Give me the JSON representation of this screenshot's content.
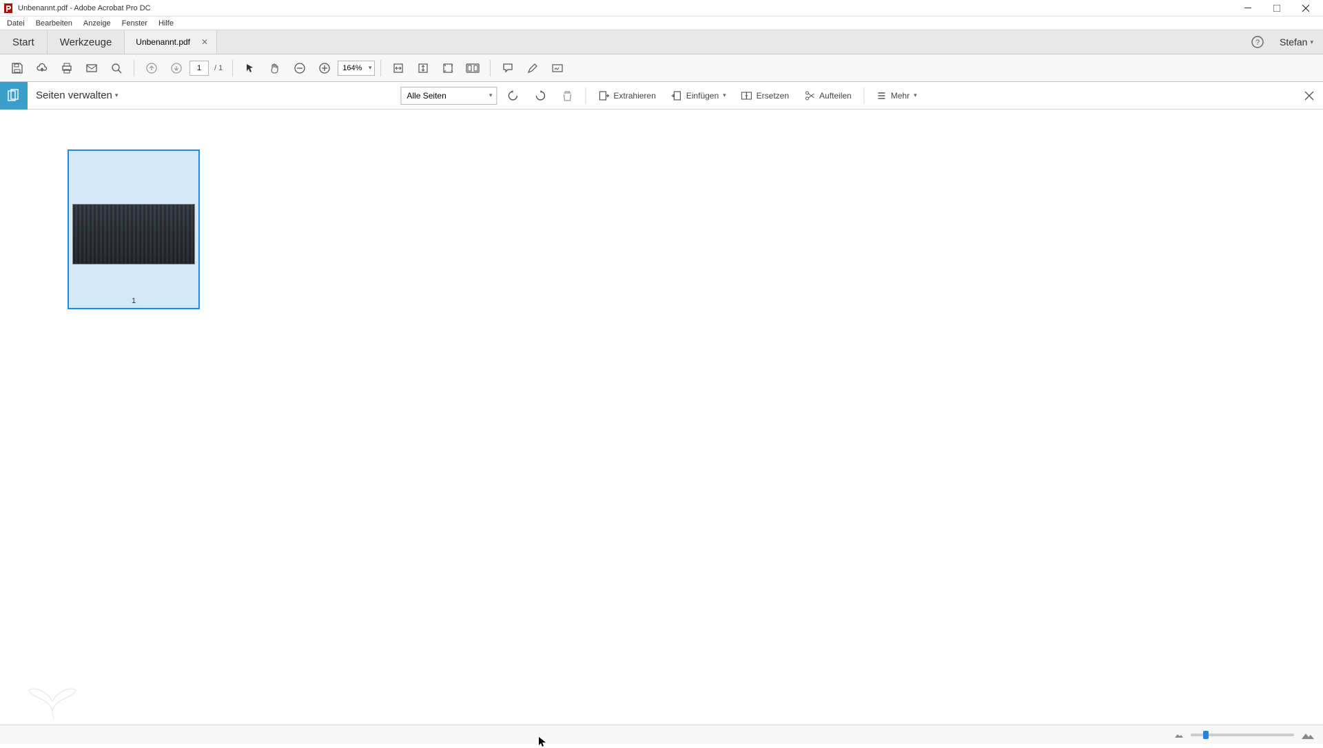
{
  "title": "Unbenannt.pdf - Adobe Acrobat Pro DC",
  "menu": {
    "datei": "Datei",
    "bearbeiten": "Bearbeiten",
    "anzeige": "Anzeige",
    "fenster": "Fenster",
    "hilfe": "Hilfe"
  },
  "tabs": {
    "start": "Start",
    "werkzeuge": "Werkzeuge",
    "doc": "Unbenannt.pdf"
  },
  "user": "Stefan",
  "toolbar": {
    "page_current": "1",
    "page_total": "/ 1",
    "zoom": "164%"
  },
  "tool": {
    "title": "Seiten verwalten",
    "filter": "Alle Seiten",
    "extract": "Extrahieren",
    "insert": "Einfügen",
    "replace": "Ersetzen",
    "split": "Aufteilen",
    "more": "Mehr"
  },
  "page": {
    "number": "1"
  }
}
